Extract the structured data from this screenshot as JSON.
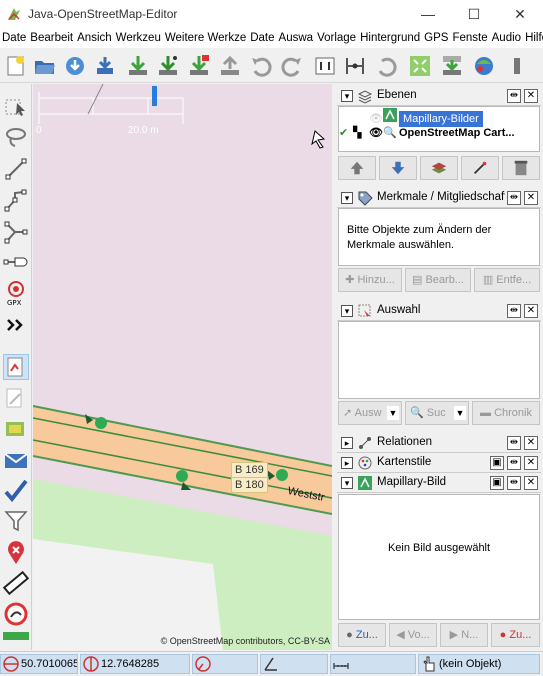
{
  "window": {
    "title": "Java-OpenStreetMap-Editor",
    "minimize": "—",
    "maximize": "☐",
    "close": "✕"
  },
  "menu": [
    "Date",
    "Bearbeit",
    "Ansich",
    "Werkzeu",
    "Weitere Werkze",
    "Date",
    "Auswa",
    "Vorlage",
    "Hintergrund",
    "GPS",
    "Fenste",
    "Audio",
    "Hilfe"
  ],
  "toolbar_icons": [
    "new-icon",
    "open-icon",
    "download-icon",
    "download-along-icon",
    "download-data-icon",
    "download-osm-icon",
    "download-notes-icon",
    "upload-icon",
    "undo-icon",
    "redo-icon",
    "preferences-icon",
    "split-way-icon",
    "revert-icon",
    "zoom-fit-icon",
    "download-in-view-icon",
    "wms-icon",
    "toolbar-end-icon"
  ],
  "left_tools": [
    "select-tool",
    "lasso-tool",
    "draw-tool",
    "way-tool",
    "improve-way-tool",
    "parallel-tool",
    "gpx-tool",
    "more-tools",
    "mapillary-select",
    "mapillary-join",
    "mapillary-edit",
    "message-tool",
    "validate-tool",
    "filter-tool",
    "remove-tool",
    "measure-tool",
    "prohibited-tool",
    "bottom-bar"
  ],
  "map": {
    "scale": {
      "zero": "0",
      "length": "20.0 m"
    },
    "road_labels": [
      "B 169",
      "B 180"
    ],
    "street_name": "Weststr",
    "attribution": "© OpenStreetMap contributors, CC-BY-SA"
  },
  "panels": {
    "layers": {
      "title": "Ebenen",
      "items": [
        {
          "name": "Mapillary-Bilder",
          "selected": true
        },
        {
          "name": "OpenStreetMap Cart...",
          "selected": false
        }
      ],
      "buttons": [
        "up-icon",
        "down-icon",
        "merge-icon",
        "activate-icon",
        "delete-icon"
      ]
    },
    "tags": {
      "title": "Merkmale / Mitgliedschafte",
      "empty_text": "Bitte Objekte zum Ändern der Merkmale auswählen.",
      "buttons": [
        "Hinzu...",
        "Bearb...",
        "Entfe..."
      ]
    },
    "selection": {
      "title": "Auswahl",
      "buttons": [
        "Ausw",
        "Suc",
        "Chronik"
      ]
    },
    "relations": {
      "title": "Relationen"
    },
    "mapstyles": {
      "title": "Kartenstile"
    },
    "mapillary_image": {
      "title": "Mapillary-Bild",
      "empty_text": "Kein Bild ausgewählt",
      "buttons": [
        "Zu...",
        "Vo...",
        "N...",
        "Zu..."
      ]
    }
  },
  "status": {
    "lat": "50.7010065",
    "lon": "12.7648285",
    "heading": "",
    "angle": "",
    "distance": "",
    "object": "(kein Objekt)"
  },
  "colors": {
    "map_background": "#eadbe6",
    "road_fill": "#f7c99b",
    "road_edge": "#3c8b3c",
    "grass": "#cdeec0",
    "selected_layer": "#3874d8",
    "status_field": "#cfe0f1"
  }
}
